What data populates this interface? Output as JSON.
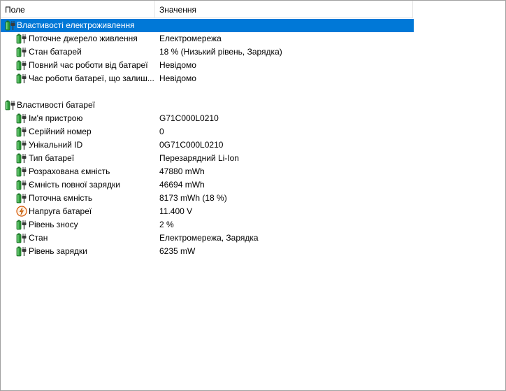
{
  "header": {
    "field": "Поле",
    "value": "Значення"
  },
  "groups": [
    {
      "label": "Властивості електроживлення",
      "selected": true,
      "items": [
        {
          "label": "Поточне джерело живлення",
          "value": "Електромережа",
          "icon": "battery-plug-icon"
        },
        {
          "label": "Стан батарей",
          "value": "18 % (Низький рівень, Зарядка)",
          "icon": "battery-plug-icon"
        },
        {
          "label": "Повний час роботи від батареї",
          "value": "Невідомо",
          "icon": "battery-plug-icon"
        },
        {
          "label": "Час роботи батареї, що залиш...",
          "value": "Невідомо",
          "icon": "battery-plug-icon"
        }
      ]
    },
    {
      "label": "Властивості батареї",
      "selected": false,
      "items": [
        {
          "label": "Ім'я пристрою",
          "value": "G71C000L0210",
          "icon": "battery-plug-icon"
        },
        {
          "label": "Серійний номер",
          "value": "0",
          "icon": "battery-plug-icon"
        },
        {
          "label": "Унікальний ID",
          "value": "0G71C000L0210",
          "icon": "battery-plug-icon"
        },
        {
          "label": "Тип батареї",
          "value": "Перезарядний Li-Ion",
          "icon": "battery-plug-icon"
        },
        {
          "label": "Розрахована ємність",
          "value": "47880 mWh",
          "icon": "battery-plug-icon"
        },
        {
          "label": "Ємність повної зарядки",
          "value": "46694 mWh",
          "icon": "battery-plug-icon"
        },
        {
          "label": "Поточна ємність",
          "value": "8173 mWh  (18 %)",
          "icon": "battery-plug-icon"
        },
        {
          "label": "Напруга батареї",
          "value": "11.400 V",
          "icon": "voltage-icon"
        },
        {
          "label": "Рівень зносу",
          "value": "2 %",
          "icon": "battery-plug-icon"
        },
        {
          "label": "Стан",
          "value": "Електромережа, Зарядка",
          "icon": "battery-plug-icon"
        },
        {
          "label": "Рівень зарядки",
          "value": "6235 mW",
          "icon": "battery-plug-icon"
        }
      ]
    }
  ]
}
